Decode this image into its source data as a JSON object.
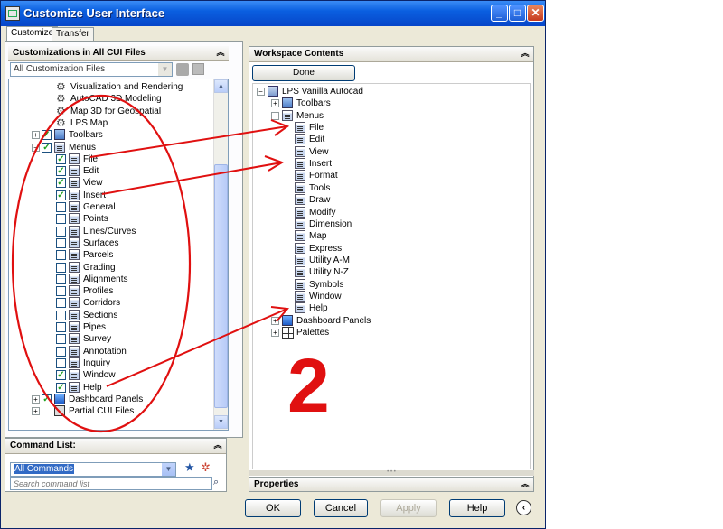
{
  "window": {
    "title": "Customize User Interface",
    "minimize": "_",
    "maximize": "□",
    "close": "✕"
  },
  "tabs": [
    {
      "label": "Customize",
      "active": true
    },
    {
      "label": "Transfer",
      "active": false
    }
  ],
  "left": {
    "header": "Customizations in All CUI Files",
    "filter_value": "All Customization Files",
    "tree": [
      {
        "label": "Visualization and Rendering",
        "icon": "gear-icon",
        "checked": null,
        "expander": null
      },
      {
        "label": "AutoCAD 3D Modeling",
        "icon": "gear-icon",
        "checked": null,
        "expander": null
      },
      {
        "label": "Map 3D for Geospatial",
        "icon": "gear-icon",
        "checked": null,
        "expander": null
      },
      {
        "label": "LPS Map",
        "icon": "gear-icon",
        "checked": null,
        "expander": null
      },
      {
        "label": "Toolbars",
        "icon": "toolbar-icon",
        "checked": true,
        "expander": "+"
      },
      {
        "label": "Menus",
        "icon": "menu-icon",
        "checked": true,
        "expander": "−"
      },
      {
        "label": "File",
        "icon": "menu-icon",
        "checked": true,
        "expander": null
      },
      {
        "label": "Edit",
        "icon": "menu-icon",
        "checked": true,
        "expander": null
      },
      {
        "label": "View",
        "icon": "menu-icon",
        "checked": true,
        "expander": null
      },
      {
        "label": "Insert",
        "icon": "menu-icon",
        "checked": true,
        "expander": null
      },
      {
        "label": "General",
        "icon": "menu-icon",
        "checked": false,
        "expander": null
      },
      {
        "label": "Points",
        "icon": "menu-icon",
        "checked": false,
        "expander": null
      },
      {
        "label": "Lines/Curves",
        "icon": "menu-icon",
        "checked": false,
        "expander": null
      },
      {
        "label": "Surfaces",
        "icon": "menu-icon",
        "checked": false,
        "expander": null
      },
      {
        "label": "Parcels",
        "icon": "menu-icon",
        "checked": false,
        "expander": null
      },
      {
        "label": "Grading",
        "icon": "menu-icon",
        "checked": false,
        "expander": null
      },
      {
        "label": "Alignments",
        "icon": "menu-icon",
        "checked": false,
        "expander": null
      },
      {
        "label": "Profiles",
        "icon": "menu-icon",
        "checked": false,
        "expander": null
      },
      {
        "label": "Corridors",
        "icon": "menu-icon",
        "checked": false,
        "expander": null
      },
      {
        "label": "Sections",
        "icon": "menu-icon",
        "checked": false,
        "expander": null
      },
      {
        "label": "Pipes",
        "icon": "menu-icon",
        "checked": false,
        "expander": null
      },
      {
        "label": "Survey",
        "icon": "menu-icon",
        "checked": false,
        "expander": null
      },
      {
        "label": "Annotation",
        "icon": "menu-icon",
        "checked": false,
        "expander": null
      },
      {
        "label": "Inquiry",
        "icon": "menu-icon",
        "checked": false,
        "expander": null
      },
      {
        "label": "Window",
        "icon": "menu-icon",
        "checked": true,
        "expander": null
      },
      {
        "label": "Help",
        "icon": "menu-icon",
        "checked": true,
        "expander": null
      },
      {
        "label": "Dashboard Panels",
        "icon": "dashboard-icon",
        "checked": true,
        "expander": "+"
      },
      {
        "label": "Partial CUI Files",
        "icon": "partial-cui-icon",
        "checked": null,
        "expander": "+"
      }
    ]
  },
  "command_list": {
    "header": "Command List:",
    "filter_value": "All Commands",
    "search_placeholder": "Search command list"
  },
  "workspace": {
    "header": "Workspace Contents",
    "done_label": "Done",
    "tree": [
      {
        "label": "LPS Vanilla Autocad",
        "icon": "workspace-icon",
        "expander": "−"
      },
      {
        "label": "Toolbars",
        "icon": "toolbar-icon",
        "expander": "+"
      },
      {
        "label": "Menus",
        "icon": "menu-icon",
        "expander": "−"
      },
      {
        "label": "File",
        "icon": "menu-icon",
        "expander": null
      },
      {
        "label": "Edit",
        "icon": "menu-icon",
        "expander": null
      },
      {
        "label": "View",
        "icon": "menu-icon",
        "expander": null
      },
      {
        "label": "Insert",
        "icon": "menu-icon",
        "expander": null
      },
      {
        "label": "Format",
        "icon": "menu-icon",
        "expander": null
      },
      {
        "label": "Tools",
        "icon": "menu-icon",
        "expander": null
      },
      {
        "label": "Draw",
        "icon": "menu-icon",
        "expander": null
      },
      {
        "label": "Modify",
        "icon": "menu-icon",
        "expander": null
      },
      {
        "label": "Dimension",
        "icon": "menu-icon",
        "expander": null
      },
      {
        "label": "Map",
        "icon": "menu-icon",
        "expander": null
      },
      {
        "label": "Express",
        "icon": "menu-icon",
        "expander": null
      },
      {
        "label": "Utility A-M",
        "icon": "menu-icon",
        "expander": null
      },
      {
        "label": "Utility N-Z",
        "icon": "menu-icon",
        "expander": null
      },
      {
        "label": "Symbols",
        "icon": "menu-icon",
        "expander": null
      },
      {
        "label": "Window",
        "icon": "menu-icon",
        "expander": null
      },
      {
        "label": "Help",
        "icon": "menu-icon",
        "expander": null
      },
      {
        "label": "Dashboard Panels",
        "icon": "dashboard-icon",
        "expander": "+"
      },
      {
        "label": "Palettes",
        "icon": "palettes-icon",
        "expander": "+"
      }
    ]
  },
  "properties": {
    "header": "Properties"
  },
  "buttons": {
    "ok": "OK",
    "cancel": "Cancel",
    "apply": "Apply",
    "help": "Help"
  },
  "annotation": {
    "number": "2",
    "color": "#e01010"
  }
}
